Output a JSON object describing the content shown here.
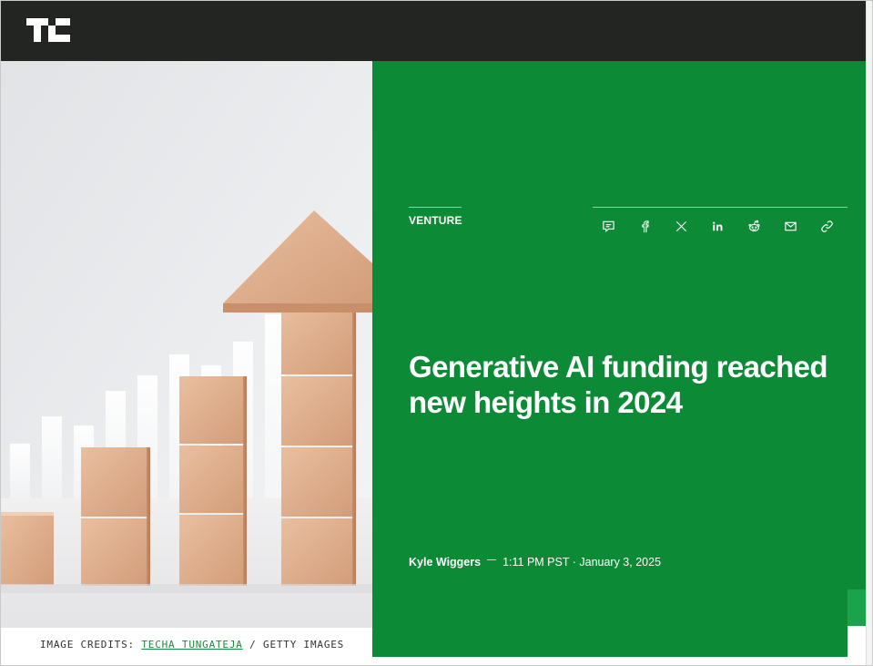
{
  "header": {
    "logo": "TC",
    "logo_icon": "techcrunch-logo"
  },
  "hero": {
    "image_description_icon": "wooden-blocks-growth-arrow-image",
    "credits_label": "IMAGE CREDITS:",
    "credits_author": "TECHA TUNGATEJA",
    "credits_separator": "/",
    "credits_source": "GETTY IMAGES"
  },
  "article": {
    "category": "VENTURE",
    "headline": "Generative AI funding reached new heights in 2024",
    "author": "Kyle Wiggers",
    "time": "1:11 PM PST · January 3, 2025",
    "share_icons": [
      "comment-icon",
      "facebook-icon",
      "x-icon",
      "linkedin-icon",
      "reddit-icon",
      "email-icon",
      "link-icon"
    ]
  },
  "colors": {
    "topbar": "#222522",
    "panel_green": "#0c8a35",
    "accent_green": "#1aa34a",
    "text_white": "#ffffff"
  }
}
